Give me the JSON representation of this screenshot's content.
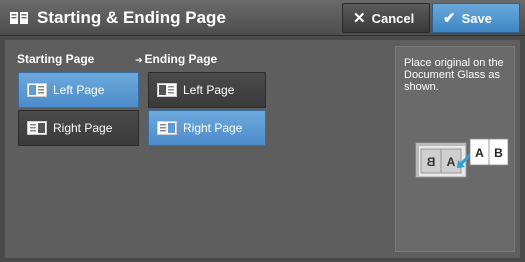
{
  "header": {
    "title": "Starting & Ending Page",
    "cancel_label": "Cancel",
    "save_label": "Save"
  },
  "starting_page": {
    "label": "Starting Page",
    "options": [
      "Left Page",
      "Right Page"
    ],
    "selected": "Left Page"
  },
  "ending_page": {
    "label": "Ending Page",
    "options": [
      "Left Page",
      "Right Page"
    ],
    "selected": "Right Page"
  },
  "info": {
    "instruction": "Place original on the Document Glass as shown.",
    "diagram_left_letters": "B A",
    "diagram_right_letters": "A B"
  },
  "colors": {
    "selected": "#5d9bd5",
    "save_button": "#4a90cd",
    "background": "#5e5e5e"
  }
}
